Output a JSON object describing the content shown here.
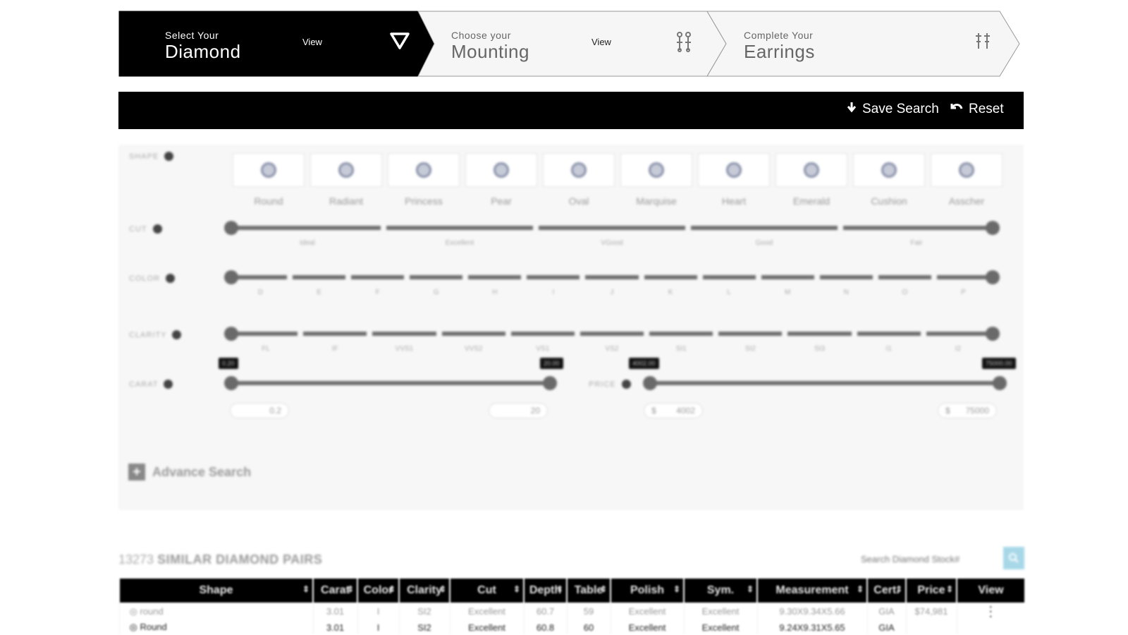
{
  "steps": [
    {
      "small": "Select Your",
      "big": "Diamond",
      "view": "View",
      "icon": "diamond-icon"
    },
    {
      "small": "Choose your",
      "big": "Mounting",
      "view": "View",
      "icon": "mounting-icon"
    },
    {
      "small": "Complete Your",
      "big": "Earrings",
      "view": "",
      "icon": "earrings-icon"
    }
  ],
  "actions": {
    "save_label": "Save Search",
    "reset_label": "Reset"
  },
  "filters": {
    "shape_label": "SHAPE",
    "shapes": [
      "Round",
      "Radiant",
      "Princess",
      "Pear",
      "Oval",
      "Marquise",
      "Heart",
      "Emerald",
      "Cushion",
      "Asscher"
    ],
    "cut_label": "CUT",
    "cut_grades": [
      "Ideal",
      "Excellent",
      "VGood",
      "Good",
      "Fair"
    ],
    "color_label": "COLOR",
    "color_grades": [
      "D",
      "E",
      "F",
      "G",
      "H",
      "I",
      "J",
      "K",
      "L",
      "M",
      "N",
      "O",
      "P"
    ],
    "clarity_label": "CLARITY",
    "clarity_grades": [
      "FL",
      "IF",
      "VVS1",
      "VVS2",
      "VS1",
      "VS2",
      "SI1",
      "SI2",
      "SI3",
      "I1",
      "I2"
    ],
    "carat_label": "CARAT",
    "carat_min_tip": "0.20",
    "carat_max_tip": "20.00",
    "carat_min_input": "0.2",
    "carat_max_input": "20",
    "price_label": "PRICE",
    "price_min_tip": "4002.00",
    "price_max_tip": "75000.00",
    "price_currency": "$",
    "price_min_input": "4002",
    "price_max_input": "75000",
    "advance_search": "Advance Search"
  },
  "results": {
    "count": "13273",
    "count_label": "SIMILAR DIAMOND PAIRS",
    "search_placeholder": "Search Diamond Stock#",
    "columns": [
      "Shape",
      "Carat",
      "Color",
      "Clarity",
      "Cut",
      "Depth",
      "Table",
      "Polish",
      "Sym.",
      "Measurement",
      "Cert.",
      "Price",
      "View"
    ],
    "rows": [
      {
        "shape": "round",
        "carat": "3.01",
        "color": "I",
        "clarity": "SI2",
        "cut": "Excellent",
        "depth": "60.7",
        "table": "59",
        "polish": "Excellent",
        "sym": "Excellent",
        "measurement": "9.30X9.34X5.66",
        "cert": "GIA",
        "price": "$74,981"
      },
      {
        "shape": "Round",
        "carat": "3.01",
        "color": "I",
        "clarity": "SI2",
        "cut": "Excellent",
        "depth": "60.8",
        "table": "60",
        "polish": "Excellent",
        "sym": "Excellent",
        "measurement": "9.24X9.31X5.65",
        "cert": "GIA",
        "price": ""
      }
    ]
  }
}
